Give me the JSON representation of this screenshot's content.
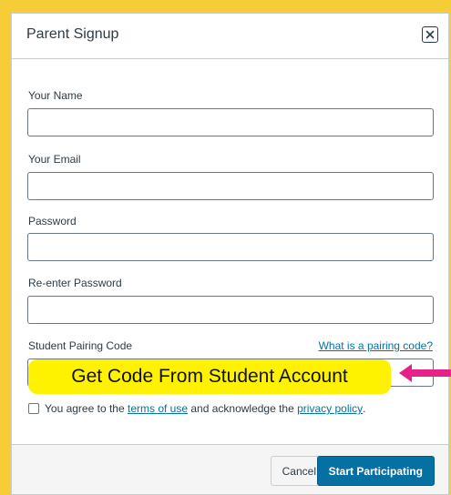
{
  "dialog": {
    "title": "Parent Signup"
  },
  "form": {
    "name_label": "Your Name",
    "email_label": "Your Email",
    "password_label": "Password",
    "reenter_label": "Re-enter Password",
    "pairing_label": "Student Pairing Code",
    "pairing_help": "What is a pairing code?"
  },
  "agreement": {
    "prefix": "You agree to the",
    "terms": "terms of use",
    "middle": "and acknowledge the",
    "privacy": "privacy policy",
    "suffix": "."
  },
  "footer": {
    "cancel": "Cancel",
    "start": "Start Participating"
  },
  "annotation": {
    "callout_text": "Get Code From Student Account",
    "arrow_color": "#e6218a",
    "callout_color": "#fff200"
  },
  "colors": {
    "background": "#f5cd37",
    "primary_button": "#0770a3",
    "link": "#0770a3"
  }
}
